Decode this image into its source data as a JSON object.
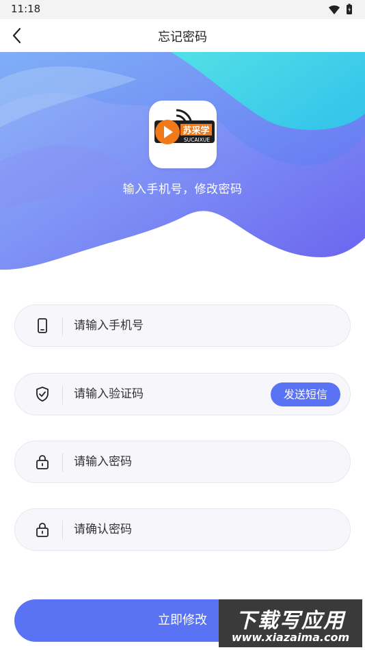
{
  "status_bar": {
    "time": "11:18",
    "icons": [
      "wifi-icon",
      "battery-icon"
    ]
  },
  "nav": {
    "title": "忘记密码",
    "back_icon": "chevron-left-icon"
  },
  "hero": {
    "logo_text": "苏采学",
    "logo_subtext": "SUCAIXUE",
    "subtitle": "输入手机号，修改密码"
  },
  "form": {
    "phone": {
      "placeholder": "请输入手机号",
      "value": "",
      "icon": "phone-icon"
    },
    "code": {
      "placeholder": "请输入验证码",
      "value": "",
      "icon": "shield-check-icon",
      "send_label": "发送短信"
    },
    "password": {
      "placeholder": "请输入密码",
      "value": "",
      "icon": "lock-icon"
    },
    "confirm": {
      "placeholder": "请确认密码",
      "value": "",
      "icon": "lock-icon"
    }
  },
  "submit_label": "立即修改",
  "watermark": {
    "main": "下载写应用",
    "url": "www.xiazaima.com"
  },
  "colors": {
    "accent": "#5a73f4",
    "hero_top": "#3fd0e6",
    "hero_bottom": "#6b6ff0",
    "logo_orange": "#f07a1a"
  }
}
